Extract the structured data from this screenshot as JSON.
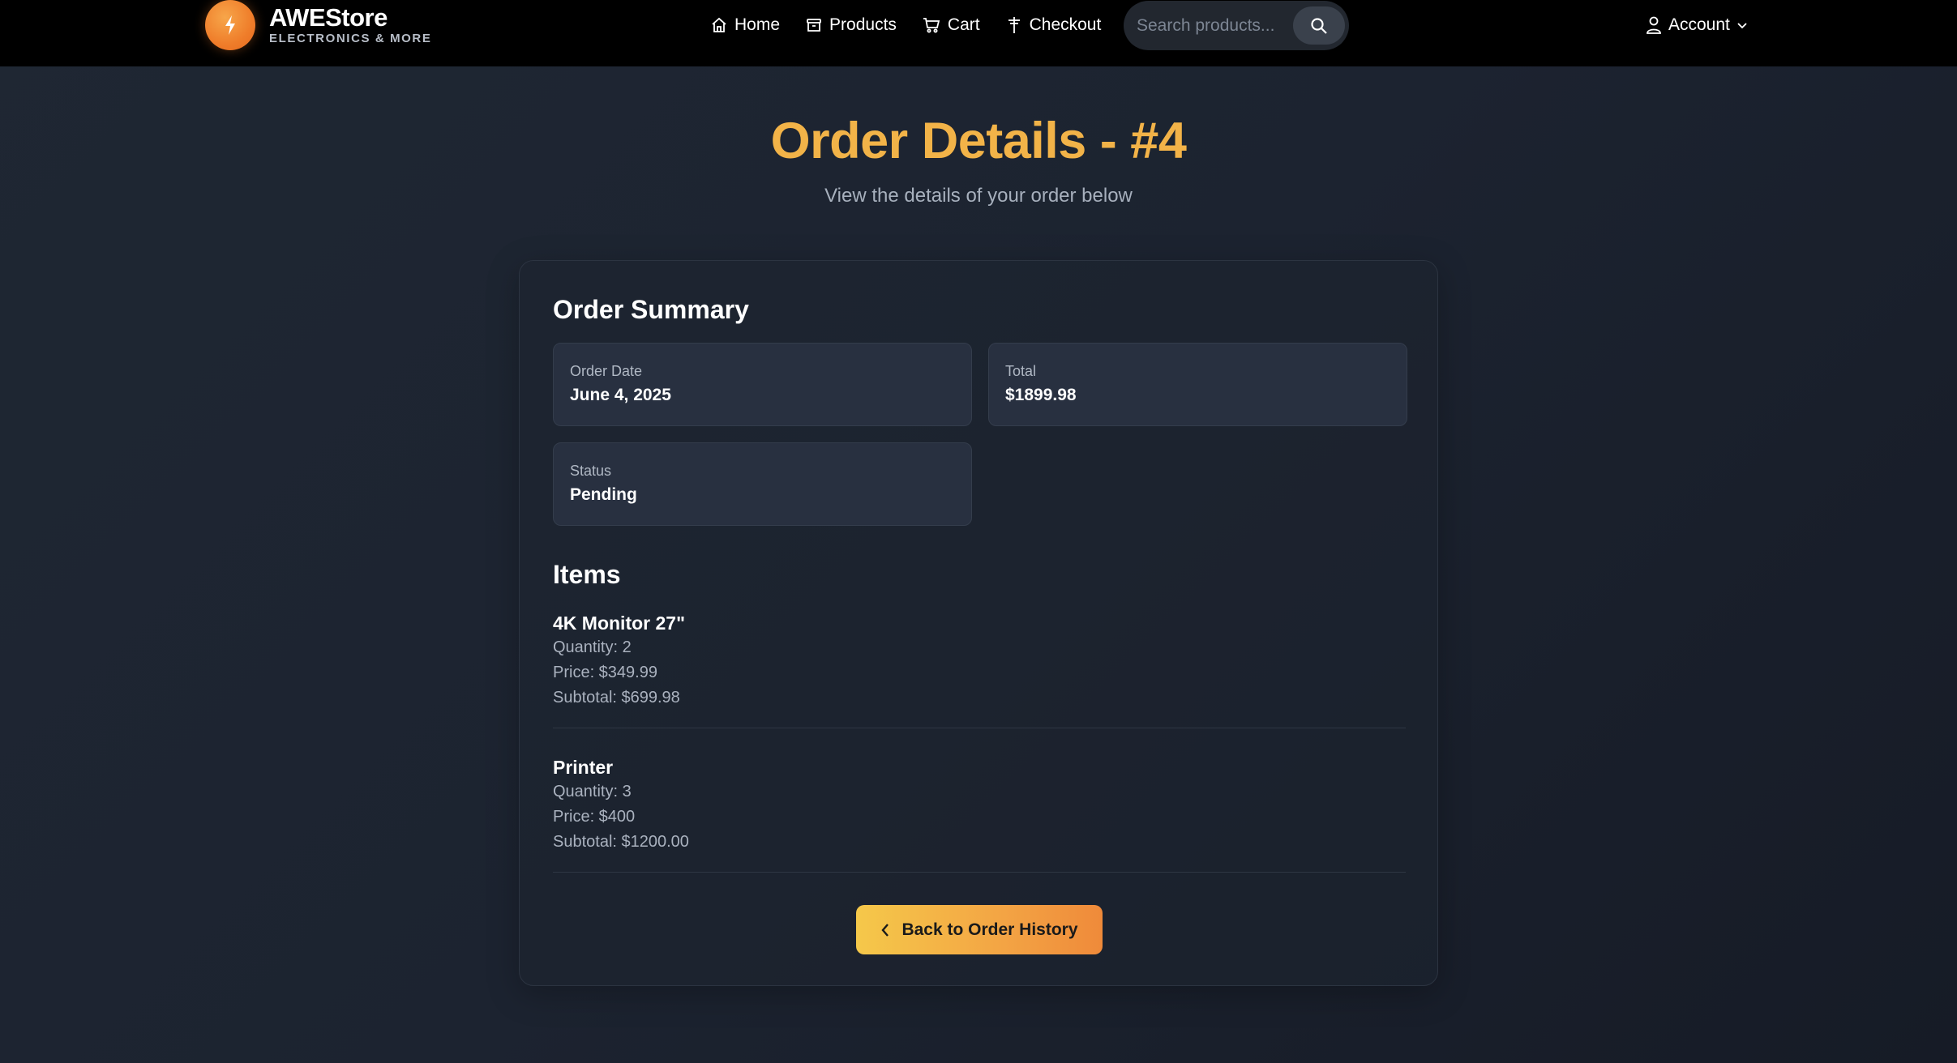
{
  "brand": {
    "name": "AWEStore",
    "tagline": "ELECTRONICS & MORE",
    "logo_icon": "lightning-icon"
  },
  "nav": {
    "links": [
      {
        "label": "Home",
        "icon": "home-icon"
      },
      {
        "label": "Products",
        "icon": "archive-box-icon"
      },
      {
        "label": "Cart",
        "icon": "cart-icon"
      },
      {
        "label": "Checkout",
        "icon": "signpost-icon"
      }
    ],
    "search_placeholder": "Search products...",
    "account_label": "Account"
  },
  "header": {
    "title": "Order Details - #4",
    "subtitle": "View the details of your order below"
  },
  "summary": {
    "heading": "Order Summary",
    "order_date_label": "Order Date",
    "order_date": "June 4, 2025",
    "total_label": "Total",
    "total": "$1899.98",
    "status_label": "Status",
    "status": "Pending"
  },
  "items": {
    "heading": "Items",
    "list": [
      {
        "name": "4K Monitor 27\"",
        "quantity": "Quantity: 2",
        "price": "Price: $349.99",
        "subtotal": "Subtotal: $699.98"
      },
      {
        "name": "Printer",
        "quantity": "Quantity: 3",
        "price": "Price: $400",
        "subtotal": "Subtotal: $1200.00"
      }
    ]
  },
  "actions": {
    "back_label": "Back to Order History"
  },
  "colors": {
    "accent": "#f2b348",
    "button_start": "#f5c84a",
    "button_end": "#ef8a3a",
    "navbar": "#000000"
  }
}
